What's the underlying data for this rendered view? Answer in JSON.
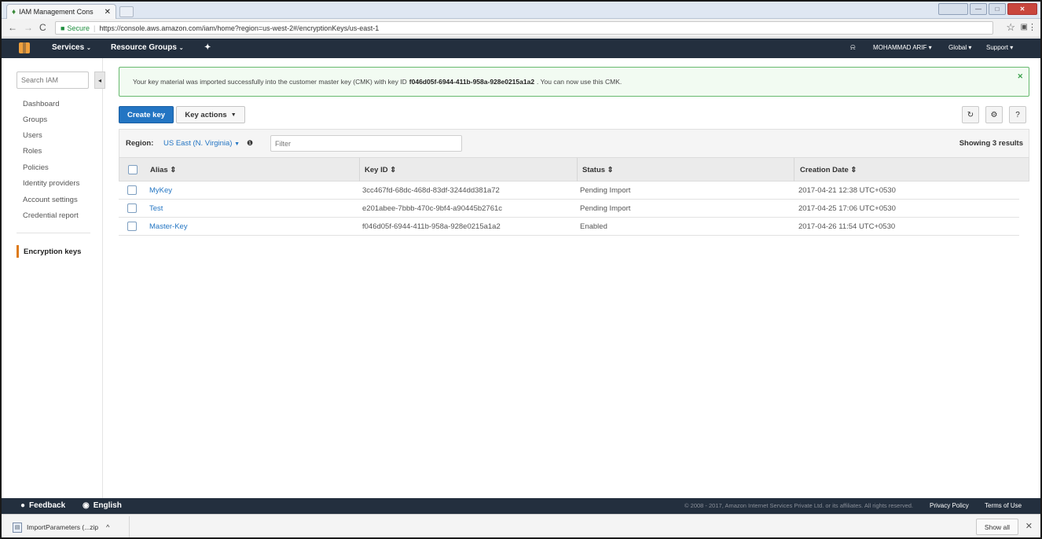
{
  "browser": {
    "tab_title": "IAM Management Cons",
    "url_secure_label": "Secure",
    "url": "https://console.aws.amazon.com/iam/home?region=us-west-2#/encryptionKeys/us-east-1"
  },
  "aws_nav": {
    "services_label": "Services",
    "resource_groups_label": "Resource Groups",
    "user_label": "MOHAMMAD ARIF",
    "region_label": "Global",
    "support_label": "Support"
  },
  "sidebar": {
    "search_placeholder": "Search IAM",
    "items": [
      {
        "label": "Dashboard"
      },
      {
        "label": "Groups"
      },
      {
        "label": "Users"
      },
      {
        "label": "Roles"
      },
      {
        "label": "Policies"
      },
      {
        "label": "Identity providers"
      },
      {
        "label": "Account settings"
      },
      {
        "label": "Credential report"
      }
    ],
    "active_item": "Encryption keys"
  },
  "alert": {
    "message_prefix": "Your key material was imported successfully into the customer master key (CMK) with key ID",
    "key_id": "f046d05f-6944-411b-958a-928e0215a1a2",
    "message_suffix": ". You can now use this CMK."
  },
  "toolbar": {
    "create_key_label": "Create key",
    "key_actions_label": "Key actions"
  },
  "filter": {
    "region_label": "Region:",
    "region_value": "US East (N. Virginia)",
    "filter_placeholder": "Filter",
    "results_text": "Showing 3 results"
  },
  "table": {
    "columns": [
      "Alias",
      "Key ID",
      "Status",
      "Creation Date"
    ],
    "rows": [
      {
        "alias": "MyKey",
        "key_id": "3cc467fd-68dc-468d-83df-3244dd381a72",
        "status": "Pending Import",
        "creation_date": "2017-04-21 12:38 UTC+0530"
      },
      {
        "alias": "Test",
        "key_id": "e201abee-7bbb-470c-9bf4-a90445b2761c",
        "status": "Pending Import",
        "creation_date": "2017-04-25 17:06 UTC+0530"
      },
      {
        "alias": "Master-Key",
        "key_id": "f046d05f-6944-411b-958a-928e0215a1a2",
        "status": "Enabled",
        "creation_date": "2017-04-26 11:54 UTC+0530"
      }
    ]
  },
  "footer": {
    "feedback_label": "Feedback",
    "language_label": "English",
    "copyright": "© 2008 - 2017, Amazon Internet Services Private Ltd. or its affiliates. All rights reserved.",
    "privacy_label": "Privacy Policy",
    "terms_label": "Terms of Use"
  },
  "downloads": {
    "file_label": "ImportParameters (...zip",
    "show_all_label": "Show all"
  },
  "colors": {
    "aws_nav_bg": "#232f3e",
    "primary_button": "#2375c3",
    "link": "#2375c3",
    "success_border": "#67b96e",
    "active_accent": "#dd7a1a"
  }
}
